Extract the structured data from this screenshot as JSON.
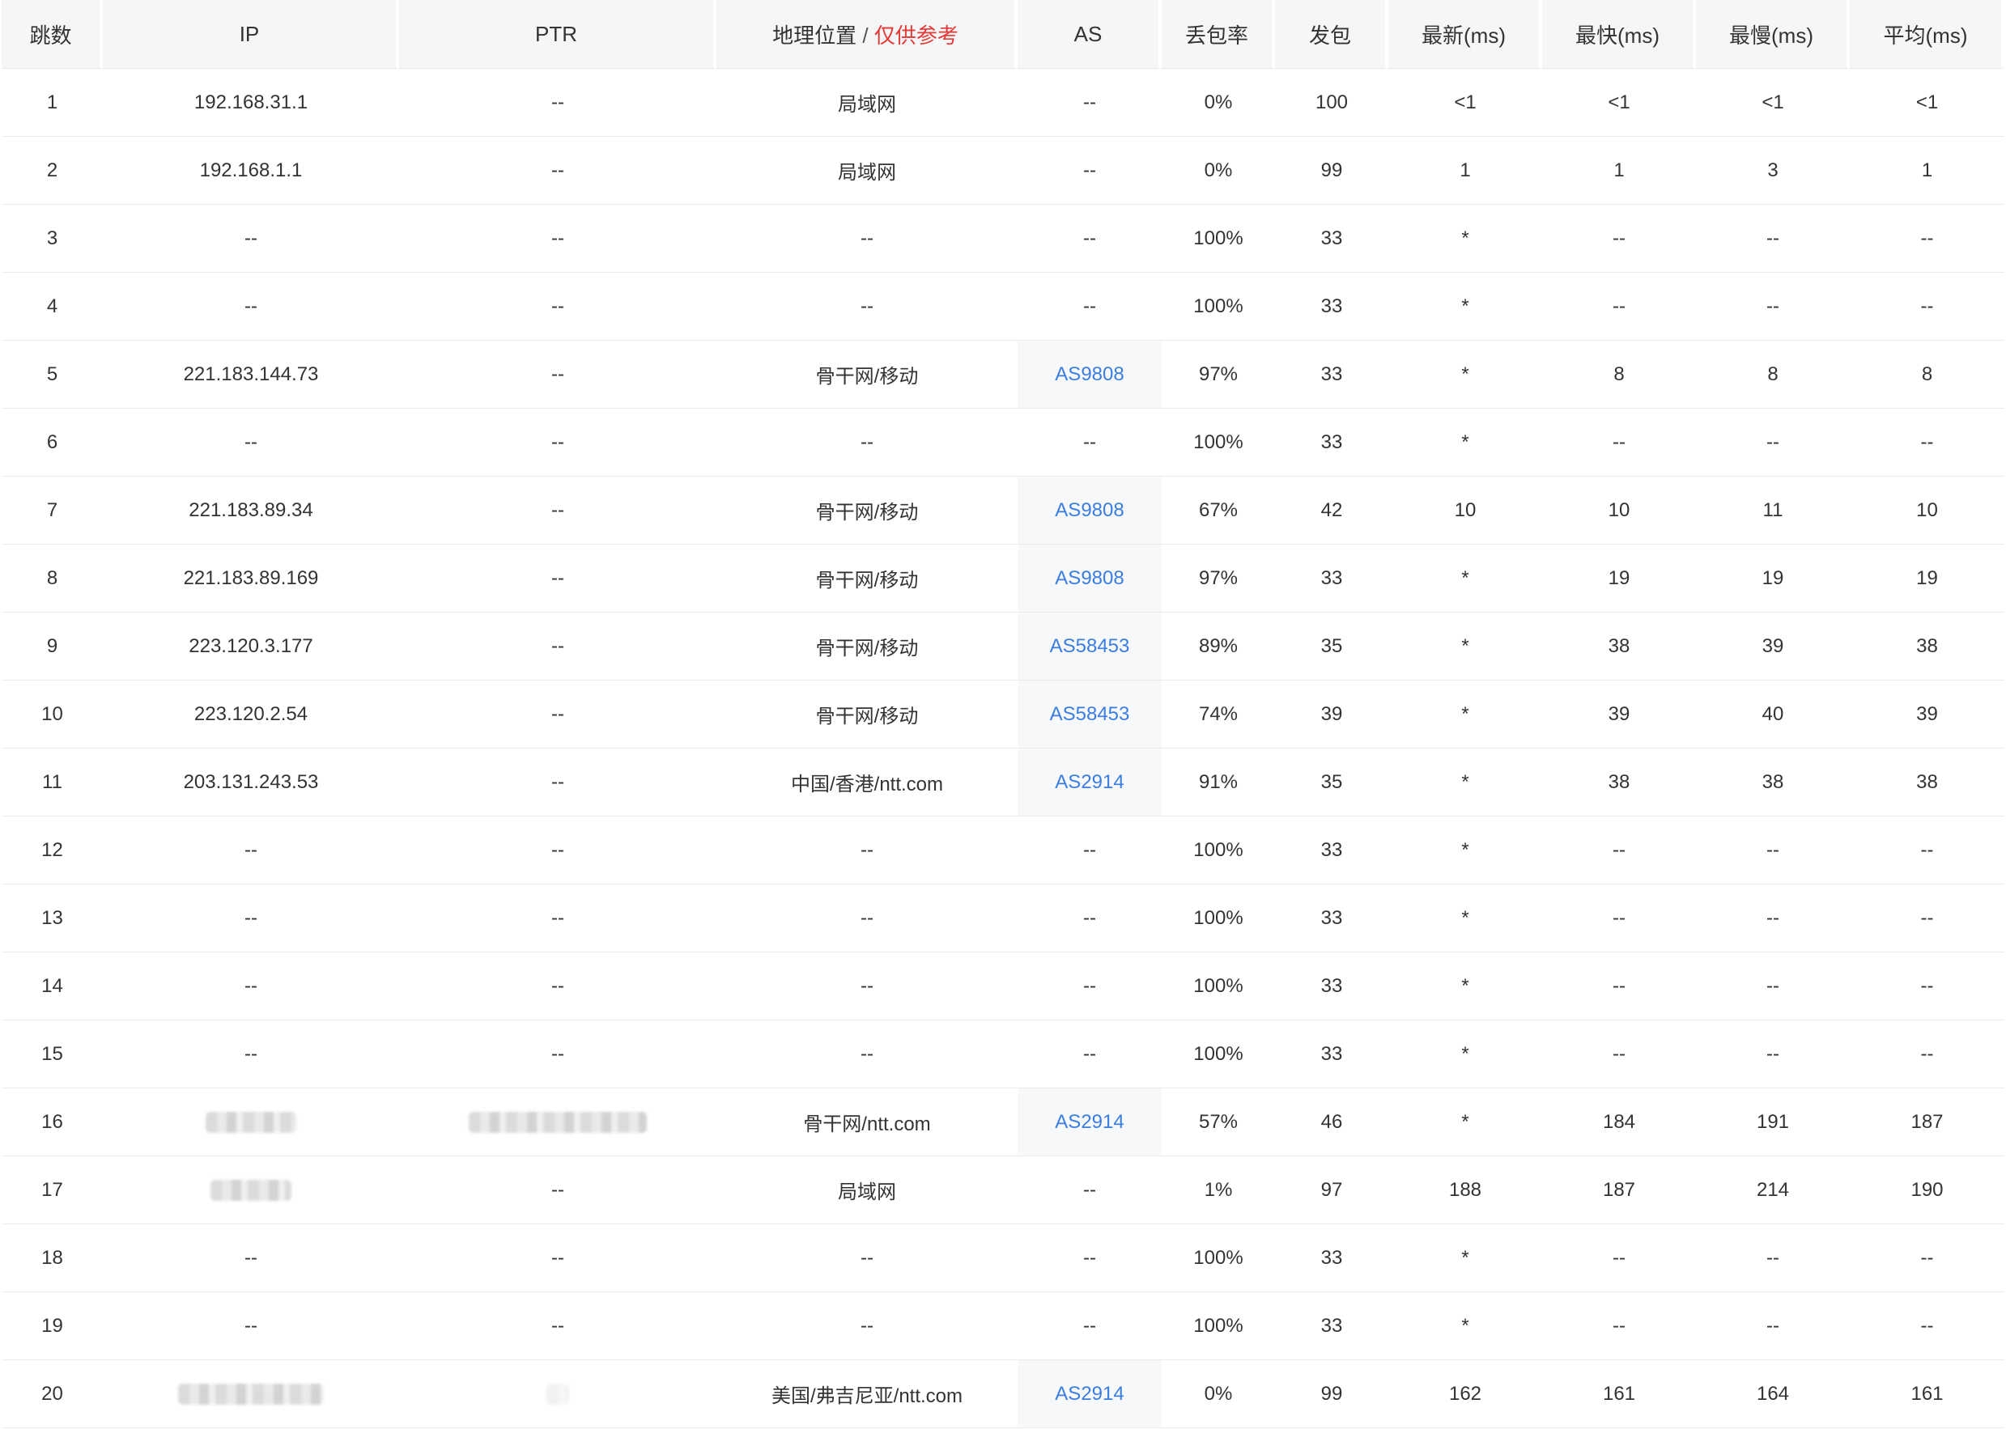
{
  "headers": {
    "hop": "跳数",
    "ip": "IP",
    "ptr": "PTR",
    "geo": "地理位置",
    "geo_sep": "/",
    "geo_note": "仅供参考",
    "as": "AS",
    "loss": "丢包率",
    "sent": "发包",
    "last": "最新(ms)",
    "best": "最快(ms)",
    "worst": "最慢(ms)",
    "avg": "平均(ms)"
  },
  "colors": {
    "header_bg": "#f5f6f7",
    "link": "#3b7de0",
    "note_red": "#e53935",
    "as_cell_bg": "#f7f8fa"
  },
  "rows": [
    {
      "hop": "1",
      "ip": "192.168.31.1",
      "ptr": "--",
      "geo": "局域网",
      "as": "--",
      "loss": "0%",
      "sent": "100",
      "last": "<1",
      "best": "<1",
      "worst": "<1",
      "avg": "<1"
    },
    {
      "hop": "2",
      "ip": "192.168.1.1",
      "ptr": "--",
      "geo": "局域网",
      "as": "--",
      "loss": "0%",
      "sent": "99",
      "last": "1",
      "best": "1",
      "worst": "3",
      "avg": "1"
    },
    {
      "hop": "3",
      "ip": "--",
      "ptr": "--",
      "geo": "--",
      "as": "--",
      "loss": "100%",
      "sent": "33",
      "last": "*",
      "best": "--",
      "worst": "--",
      "avg": "--"
    },
    {
      "hop": "4",
      "ip": "--",
      "ptr": "--",
      "geo": "--",
      "as": "--",
      "loss": "100%",
      "sent": "33",
      "last": "*",
      "best": "--",
      "worst": "--",
      "avg": "--"
    },
    {
      "hop": "5",
      "ip": "221.183.144.73",
      "ptr": "--",
      "geo": "骨干网/移动",
      "as": "AS9808",
      "loss": "97%",
      "sent": "33",
      "last": "*",
      "best": "8",
      "worst": "8",
      "avg": "8"
    },
    {
      "hop": "6",
      "ip": "--",
      "ptr": "--",
      "geo": "--",
      "as": "--",
      "loss": "100%",
      "sent": "33",
      "last": "*",
      "best": "--",
      "worst": "--",
      "avg": "--"
    },
    {
      "hop": "7",
      "ip": "221.183.89.34",
      "ptr": "--",
      "geo": "骨干网/移动",
      "as": "AS9808",
      "loss": "67%",
      "sent": "42",
      "last": "10",
      "best": "10",
      "worst": "11",
      "avg": "10"
    },
    {
      "hop": "8",
      "ip": "221.183.89.169",
      "ptr": "--",
      "geo": "骨干网/移动",
      "as": "AS9808",
      "loss": "97%",
      "sent": "33",
      "last": "*",
      "best": "19",
      "worst": "19",
      "avg": "19"
    },
    {
      "hop": "9",
      "ip": "223.120.3.177",
      "ptr": "--",
      "geo": "骨干网/移动",
      "as": "AS58453",
      "loss": "89%",
      "sent": "35",
      "last": "*",
      "best": "38",
      "worst": "39",
      "avg": "38"
    },
    {
      "hop": "10",
      "ip": "223.120.2.54",
      "ptr": "--",
      "geo": "骨干网/移动",
      "as": "AS58453",
      "loss": "74%",
      "sent": "39",
      "last": "*",
      "best": "39",
      "worst": "40",
      "avg": "39"
    },
    {
      "hop": "11",
      "ip": "203.131.243.53",
      "ptr": "--",
      "geo": "中国/香港/ntt.com",
      "as": "AS2914",
      "loss": "91%",
      "sent": "35",
      "last": "*",
      "best": "38",
      "worst": "38",
      "avg": "38"
    },
    {
      "hop": "12",
      "ip": "--",
      "ptr": "--",
      "geo": "--",
      "as": "--",
      "loss": "100%",
      "sent": "33",
      "last": "*",
      "best": "--",
      "worst": "--",
      "avg": "--"
    },
    {
      "hop": "13",
      "ip": "--",
      "ptr": "--",
      "geo": "--",
      "as": "--",
      "loss": "100%",
      "sent": "33",
      "last": "*",
      "best": "--",
      "worst": "--",
      "avg": "--"
    },
    {
      "hop": "14",
      "ip": "--",
      "ptr": "--",
      "geo": "--",
      "as": "--",
      "loss": "100%",
      "sent": "33",
      "last": "*",
      "best": "--",
      "worst": "--",
      "avg": "--"
    },
    {
      "hop": "15",
      "ip": "--",
      "ptr": "--",
      "geo": "--",
      "as": "--",
      "loss": "100%",
      "sent": "33",
      "last": "*",
      "best": "--",
      "worst": "--",
      "avg": "--"
    },
    {
      "hop": "16",
      "ip": "",
      "ip_redacted": true,
      "ptr": "",
      "ptr_redacted": true,
      "geo": "骨干网/ntt.com",
      "as": "AS2914",
      "loss": "57%",
      "sent": "46",
      "last": "*",
      "best": "184",
      "worst": "191",
      "avg": "187"
    },
    {
      "hop": "17",
      "ip": "",
      "ip_redacted": true,
      "ptr": "--",
      "geo": "局域网",
      "as": "--",
      "loss": "1%",
      "sent": "97",
      "last": "188",
      "best": "187",
      "worst": "214",
      "avg": "190"
    },
    {
      "hop": "18",
      "ip": "--",
      "ptr": "--",
      "geo": "--",
      "as": "--",
      "loss": "100%",
      "sent": "33",
      "last": "*",
      "best": "--",
      "worst": "--",
      "avg": "--"
    },
    {
      "hop": "19",
      "ip": "--",
      "ptr": "--",
      "geo": "--",
      "as": "--",
      "loss": "100%",
      "sent": "33",
      "last": "*",
      "best": "--",
      "worst": "--",
      "avg": "--"
    },
    {
      "hop": "20",
      "ip": "",
      "ip_redacted": true,
      "ptr": "",
      "ptr_redacted": true,
      "geo": "美国/弗吉尼亚/ntt.com",
      "as": "AS2914",
      "loss": "0%",
      "sent": "99",
      "last": "162",
      "best": "161",
      "worst": "164",
      "avg": "161"
    }
  ]
}
